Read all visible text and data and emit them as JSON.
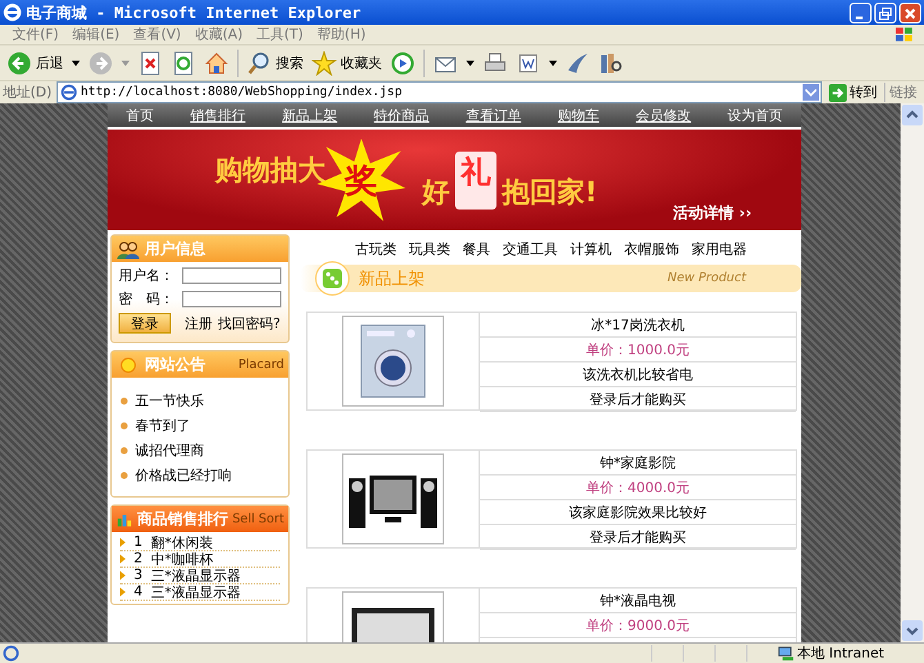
{
  "window": {
    "title": "电子商城 - Microsoft Internet Explorer"
  },
  "menu": [
    "文件(F)",
    "编辑(E)",
    "查看(V)",
    "收藏(A)",
    "工具(T)",
    "帮助(H)"
  ],
  "toolbar": {
    "back": "后退",
    "search": "搜索",
    "favorites": "收藏夹"
  },
  "address_bar": {
    "label": "地址(D)",
    "url": "http://localhost:8080/WebShopping/index.jsp",
    "go": "转到",
    "links": "链接"
  },
  "nav": [
    {
      "label": "首页",
      "link": false
    },
    {
      "label": "销售排行",
      "link": true
    },
    {
      "label": "新品上架",
      "link": true
    },
    {
      "label": "特价商品",
      "link": true
    },
    {
      "label": "查看订单",
      "link": true
    },
    {
      "label": "购物车",
      "link": true
    },
    {
      "label": "会员修改",
      "link": true
    },
    {
      "label": "设为首页",
      "link": false
    }
  ],
  "banner": {
    "headline": "购物抽大",
    "headline_accent": "奖",
    "slogan_start": "好",
    "slogan_accent": "礼",
    "slogan_end": "抱回家!",
    "details_link": "活动详情 ››"
  },
  "login": {
    "title": "用户信息",
    "username_label": "用户名：",
    "password_label": "密　码：",
    "login_button": "登录",
    "register_link": "注册",
    "recover_link": "找回密码?"
  },
  "placard": {
    "title": "网站公告",
    "subtitle": "Placard",
    "items": [
      "五一节快乐",
      "春节到了",
      "诚招代理商",
      "价格战已经打响"
    ]
  },
  "sales_rank": {
    "title": "商品销售排行",
    "subtitle": "Sell Sort",
    "items": [
      {
        "rank": "1",
        "name": "翻*休闲装"
      },
      {
        "rank": "2",
        "name": "中*咖啡杯"
      },
      {
        "rank": "3",
        "name": "三*液晶显示器"
      },
      {
        "rank": "4",
        "name": "三*液晶显示器"
      }
    ]
  },
  "categories": [
    "古玩类",
    "玩具类",
    "餐具",
    "交通工具",
    "计算机",
    "衣帽服饰",
    "家用电器"
  ],
  "section": {
    "title": "新品上架",
    "subtitle": "New Product"
  },
  "products": [
    {
      "kind": "washer",
      "name": "冰*17岗洗衣机",
      "price": "单价：1000.0元",
      "description": "该洗衣机比较省电",
      "note": "登录后才能购买"
    },
    {
      "kind": "theater",
      "name": "钟*家庭影院",
      "price": "单价：4000.0元",
      "description": "该家庭影院效果比较好",
      "note": "登录后才能购买"
    },
    {
      "kind": "tv",
      "name": "钟*液晶电视",
      "price": "单价：9000.0元"
    }
  ],
  "status_bar": {
    "zone": "本地 Intranet"
  }
}
